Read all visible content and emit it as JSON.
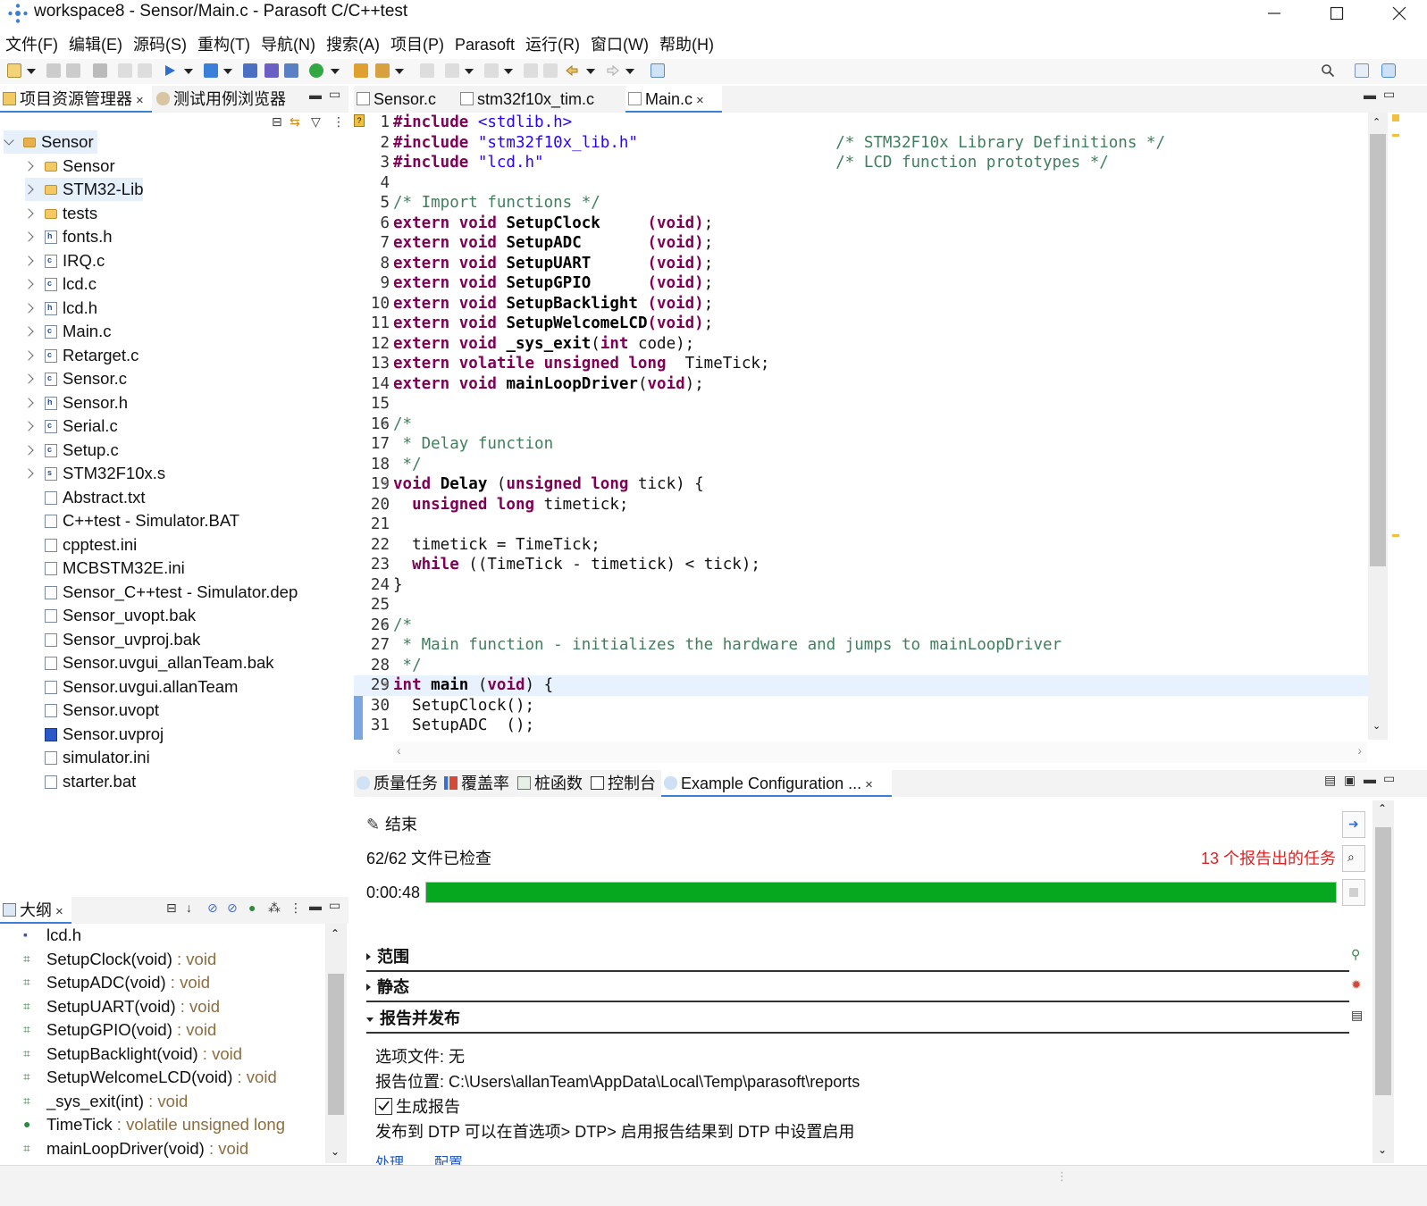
{
  "window": {
    "title": "workspace8 - Sensor/Main.c - Parasoft C/C++test"
  },
  "menu": [
    "文件(F)",
    "编辑(E)",
    "源码(S)",
    "重构(T)",
    "导航(N)",
    "搜索(A)",
    "项目(P)",
    "Parasoft",
    "运行(R)",
    "窗口(W)",
    "帮助(H)"
  ],
  "explorer": {
    "tabs": [
      {
        "label": "项目资源管理器",
        "close": "×"
      },
      {
        "label": "测试用例浏览器"
      }
    ],
    "root": "Sensor",
    "items": [
      {
        "label": "Sensor",
        "kind": "folder",
        "expandable": true
      },
      {
        "label": "STM32-Lib",
        "kind": "folder",
        "expandable": true
      },
      {
        "label": "tests",
        "kind": "folder",
        "expandable": true
      },
      {
        "label": "fonts.h",
        "kind": "h",
        "expandable": true
      },
      {
        "label": "IRQ.c",
        "kind": "c",
        "expandable": true
      },
      {
        "label": "lcd.c",
        "kind": "c",
        "expandable": true
      },
      {
        "label": "lcd.h",
        "kind": "h",
        "expandable": true
      },
      {
        "label": "Main.c",
        "kind": "c",
        "expandable": true
      },
      {
        "label": "Retarget.c",
        "kind": "c",
        "expandable": true
      },
      {
        "label": "Sensor.c",
        "kind": "c",
        "expandable": true
      },
      {
        "label": "Sensor.h",
        "kind": "h",
        "expandable": true
      },
      {
        "label": "Serial.c",
        "kind": "c",
        "expandable": true
      },
      {
        "label": "Setup.c",
        "kind": "c",
        "expandable": true
      },
      {
        "label": "STM32F10x.s",
        "kind": "s",
        "expandable": true
      },
      {
        "label": "Abstract.txt",
        "kind": "txt",
        "expandable": false
      },
      {
        "label": "C++test - Simulator.BAT",
        "kind": "bat",
        "expandable": false
      },
      {
        "label": "cpptest.ini",
        "kind": "ini",
        "expandable": false
      },
      {
        "label": "MCBSTM32E.ini",
        "kind": "ini",
        "expandable": false
      },
      {
        "label": "Sensor_C++test - Simulator.dep",
        "kind": "txt",
        "expandable": false
      },
      {
        "label": "Sensor_uvopt.bak",
        "kind": "txt",
        "expandable": false
      },
      {
        "label": "Sensor_uvproj.bak",
        "kind": "txt",
        "expandable": false
      },
      {
        "label": "Sensor.uvgui_allanTeam.bak",
        "kind": "txt",
        "expandable": false
      },
      {
        "label": "Sensor.uvgui.allanTeam",
        "kind": "txt",
        "expandable": false
      },
      {
        "label": "Sensor.uvopt",
        "kind": "txt",
        "expandable": false
      },
      {
        "label": "Sensor.uvproj",
        "kind": "uv",
        "expandable": false
      },
      {
        "label": "simulator.ini",
        "kind": "ini",
        "expandable": false
      },
      {
        "label": "starter.bat",
        "kind": "bat",
        "expandable": false
      }
    ]
  },
  "editor": {
    "tabs": [
      {
        "label": "Sensor.c"
      },
      {
        "label": "stm32f10x_tim.c"
      },
      {
        "label": "Main.c",
        "close": "×"
      }
    ],
    "lines": [
      {
        "n": "1",
        "fold": "",
        "parts": [
          [
            "kw",
            "#include "
          ],
          [
            "str",
            "<stdlib.h>"
          ]
        ]
      },
      {
        "n": "2",
        "fold": "",
        "parts": [
          [
            "kw",
            "#include "
          ],
          [
            "str",
            "\"stm32f10x_lib.h\""
          ],
          [
            "",
            "                     "
          ],
          [
            "cmt",
            "/* STM32F10x Library Definitions */"
          ]
        ]
      },
      {
        "n": "3",
        "fold": "",
        "parts": [
          [
            "kw",
            "#include "
          ],
          [
            "str",
            "\"lcd.h\""
          ],
          [
            "",
            "                               "
          ],
          [
            "cmt",
            "/* LCD function prototypes */"
          ]
        ]
      },
      {
        "n": "4",
        "fold": "",
        "parts": []
      },
      {
        "n": "5",
        "fold": "",
        "parts": [
          [
            "cmt",
            "/* Import functions */"
          ]
        ]
      },
      {
        "n": "6",
        "fold": "",
        "parts": [
          [
            "kw",
            "extern void "
          ],
          [
            "fn",
            "SetupClock"
          ],
          [
            "",
            "     "
          ],
          [
            "kw",
            "(void)"
          ],
          [
            "",
            ";"
          ]
        ]
      },
      {
        "n": "7",
        "fold": "",
        "parts": [
          [
            "kw",
            "extern void "
          ],
          [
            "fn",
            "SetupADC"
          ],
          [
            "",
            "       "
          ],
          [
            "kw",
            "(void)"
          ],
          [
            "",
            ";"
          ]
        ]
      },
      {
        "n": "8",
        "fold": "",
        "parts": [
          [
            "kw",
            "extern void "
          ],
          [
            "fn",
            "SetupUART"
          ],
          [
            "",
            "      "
          ],
          [
            "kw",
            "(void)"
          ],
          [
            "",
            ";"
          ]
        ]
      },
      {
        "n": "9",
        "fold": "",
        "parts": [
          [
            "kw",
            "extern void "
          ],
          [
            "fn",
            "SetupGPIO"
          ],
          [
            "",
            "      "
          ],
          [
            "kw",
            "(void)"
          ],
          [
            "",
            ";"
          ]
        ]
      },
      {
        "n": "10",
        "fold": "",
        "parts": [
          [
            "kw",
            "extern void "
          ],
          [
            "fn",
            "SetupBacklight"
          ],
          [
            "",
            " "
          ],
          [
            "kw",
            "(void)"
          ],
          [
            "",
            ";"
          ]
        ]
      },
      {
        "n": "11",
        "fold": "",
        "parts": [
          [
            "kw",
            "extern void "
          ],
          [
            "fn",
            "SetupWelcomeLCD"
          ],
          [
            "kw",
            "(void)"
          ],
          [
            "",
            ";"
          ]
        ]
      },
      {
        "n": "12",
        "fold": "",
        "parts": [
          [
            "kw",
            "extern void "
          ],
          [
            "fn",
            "_sys_exit"
          ],
          [
            "",
            "("
          ],
          [
            "kw",
            "int"
          ],
          [
            "",
            " code);"
          ]
        ]
      },
      {
        "n": "13",
        "fold": "",
        "parts": [
          [
            "kw",
            "extern volatile unsigned long "
          ],
          [
            "",
            " TimeTick;"
          ]
        ]
      },
      {
        "n": "14",
        "fold": "",
        "parts": [
          [
            "kw",
            "extern void "
          ],
          [
            "fn",
            "mainLoopDriver"
          ],
          [
            "",
            "("
          ],
          [
            "kw",
            "void"
          ],
          [
            "",
            ");"
          ]
        ]
      },
      {
        "n": "15",
        "fold": "",
        "parts": []
      },
      {
        "n": "16",
        "fold": "⊖",
        "parts": [
          [
            "cmt",
            "/*"
          ]
        ]
      },
      {
        "n": "17",
        "fold": "",
        "parts": [
          [
            "cmt",
            " * Delay function"
          ]
        ]
      },
      {
        "n": "18",
        "fold": "",
        "parts": [
          [
            "cmt",
            " */"
          ]
        ]
      },
      {
        "n": "19",
        "fold": "⊖",
        "parts": [
          [
            "kw",
            "void "
          ],
          [
            "fn",
            "Delay"
          ],
          [
            "",
            " ("
          ],
          [
            "kw",
            "unsigned long"
          ],
          [
            "",
            " tick) {"
          ]
        ]
      },
      {
        "n": "20",
        "fold": "",
        "parts": [
          [
            "",
            "  "
          ],
          [
            "kw",
            "unsigned long"
          ],
          [
            "",
            " timetick;"
          ]
        ]
      },
      {
        "n": "21",
        "fold": "",
        "parts": []
      },
      {
        "n": "22",
        "fold": "",
        "parts": [
          [
            "",
            "  timetick = TimeTick;"
          ]
        ]
      },
      {
        "n": "23",
        "fold": "",
        "parts": [
          [
            "",
            "  "
          ],
          [
            "kw",
            "while"
          ],
          [
            "",
            " ((TimeTick - timetick) < tick);"
          ]
        ]
      },
      {
        "n": "24",
        "fold": "",
        "parts": [
          [
            "",
            "}"
          ]
        ]
      },
      {
        "n": "25",
        "fold": "",
        "parts": []
      },
      {
        "n": "26",
        "fold": "⊖",
        "parts": [
          [
            "cmt",
            "/*"
          ]
        ]
      },
      {
        "n": "27",
        "fold": "",
        "parts": [
          [
            "cmt",
            " * Main function - initializes the hardware and jumps to mainLoopDriver"
          ]
        ]
      },
      {
        "n": "28",
        "fold": "",
        "parts": [
          [
            "cmt",
            " */"
          ]
        ]
      },
      {
        "n": "29",
        "fold": "⊖",
        "parts": [
          [
            "kw",
            "int "
          ],
          [
            "fn",
            "main"
          ],
          [
            "",
            " ("
          ],
          [
            "kw",
            "void"
          ],
          [
            "",
            ") {"
          ]
        ]
      },
      {
        "n": "30",
        "fold": "",
        "parts": [
          [
            "",
            "  SetupClock();"
          ]
        ]
      },
      {
        "n": "31",
        "fold": "",
        "parts": [
          [
            "",
            "  SetupADC  ();"
          ]
        ]
      }
    ]
  },
  "outline": {
    "tab": "大纲",
    "close": "×",
    "items": [
      {
        "name": "lcd.h",
        "type": "",
        "icon": "include-icon"
      },
      {
        "name": "SetupClock(void)",
        "type": " : void",
        "icon": "function-icon"
      },
      {
        "name": "SetupADC(void)",
        "type": " : void",
        "icon": "function-icon"
      },
      {
        "name": "SetupUART(void)",
        "type": " : void",
        "icon": "function-icon"
      },
      {
        "name": "SetupGPIO(void)",
        "type": " : void",
        "icon": "function-icon"
      },
      {
        "name": "SetupBacklight(void)",
        "type": " : void",
        "icon": "function-icon"
      },
      {
        "name": "SetupWelcomeLCD(void)",
        "type": " : void",
        "icon": "function-icon"
      },
      {
        "name": "_sys_exit(int)",
        "type": " : void",
        "icon": "function-icon"
      },
      {
        "name": "TimeTick",
        "type": " : volatile unsigned long",
        "icon": "variable-icon"
      },
      {
        "name": "mainLoopDriver(void)",
        "type": " : void",
        "icon": "function-icon"
      }
    ]
  },
  "bottom": {
    "tabs": [
      {
        "label": "质量任务"
      },
      {
        "label": "覆盖率"
      },
      {
        "label": "桩函数"
      },
      {
        "label": "控制台"
      },
      {
        "label": "Example Configuration ...",
        "close": "×"
      }
    ],
    "status": "结束",
    "files_checked": "62/62 文件已检查",
    "tasks_reported": "13 个报告出的任务",
    "elapsed": "0:00:48",
    "progress": 1.0,
    "sections": [
      {
        "label": "范围",
        "open": false
      },
      {
        "label": "静态",
        "open": false
      },
      {
        "label": "报告并发布",
        "open": true
      }
    ],
    "options_file": "选项文件: 无",
    "report_location": "报告位置: C:\\Users\\allanTeam\\AppData\\Local\\Temp\\parasoft\\reports",
    "generate_report": "生成报告",
    "publish_note": "发布到 DTP 可以在首选项> DTP> 启用报告结果到 DTP 中设置启用",
    "link1": "处理",
    "link2": "配置"
  },
  "colors": {
    "progress": "#06a820",
    "tasks_red": "#e02020",
    "keyword": "#7f0055",
    "string": "#2a00ff",
    "comment": "#3f7f5f"
  }
}
